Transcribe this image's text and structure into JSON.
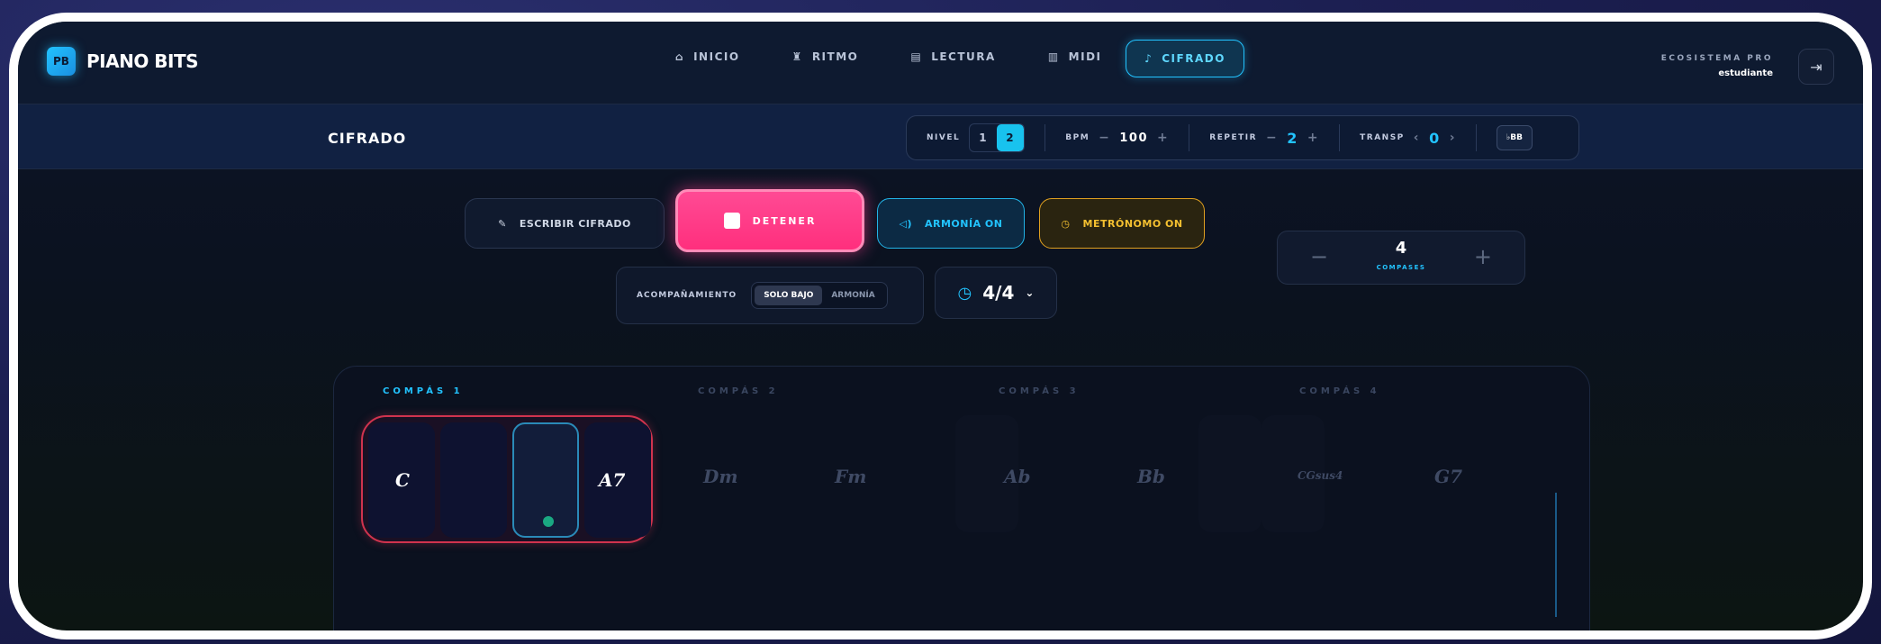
{
  "app": {
    "logo_badge": "PB",
    "logo_text": "PIANO BITS"
  },
  "nav": {
    "items": [
      {
        "icon": "⌂",
        "label": "INICIO"
      },
      {
        "icon": "♜",
        "label": "RITMO"
      },
      {
        "icon": "▤",
        "label": "LECTURA"
      },
      {
        "icon": "▥",
        "label": "MIDI"
      }
    ],
    "active": {
      "icon": "♪",
      "label": "CIFRADO"
    }
  },
  "account": {
    "title": "ECOSISTEMA PRO",
    "user": "estudiante"
  },
  "subheader": {
    "title": "CIFRADO",
    "nivel_label": "NIVEL",
    "nivel_options": [
      "1",
      "2"
    ],
    "bpm_label": "BPM",
    "bpm_value": "100",
    "repetir_label": "REPETIR",
    "repetir_value": "2",
    "transp_label": "TRANSP",
    "transp_value": "0",
    "accidental_button": "♭BB"
  },
  "actions": {
    "write": "ESCRIBIR CIFRADO",
    "stop": "DETENER",
    "harmony": "ARMONÍA ON",
    "metronome": "METRÓNOMO ON"
  },
  "accompaniment": {
    "label": "ACOMPAÑAMIENTO",
    "options": [
      "SOLO BAJO",
      "ARMONÍA"
    ],
    "selected": "SOLO BAJO"
  },
  "time_signature": "4/4",
  "bars": {
    "count": "4",
    "label": "COMPASES"
  },
  "measures": [
    {
      "label": "COMPÁS 1",
      "chords": [
        "C",
        "A7"
      ]
    },
    {
      "label": "COMPÁS 2",
      "chords": [
        "Dm",
        "Fm"
      ]
    },
    {
      "label": "COMPÁS 3",
      "chords": [
        "Ab",
        "Bb"
      ]
    },
    {
      "label": "COMPÁS 4",
      "chords": [
        "CGsus4",
        "G7"
      ]
    }
  ],
  "colors": {
    "accent": "#22c3ff",
    "stop": "#ff2f7d",
    "metronome": "#f4c030",
    "measure_active": "#d0334e"
  }
}
